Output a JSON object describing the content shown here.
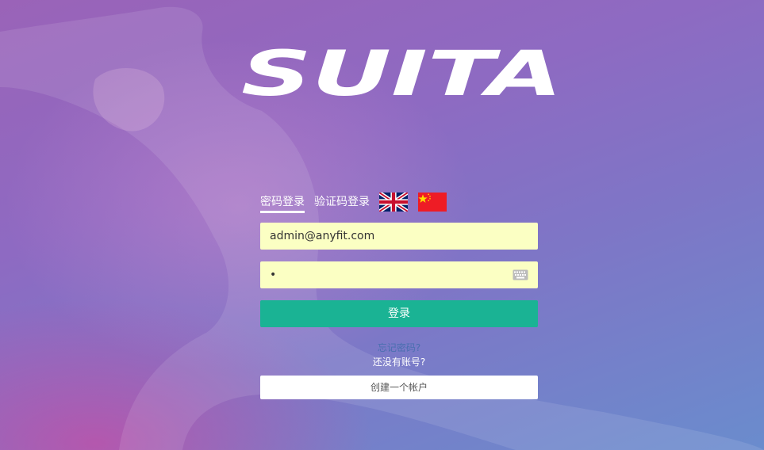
{
  "brand": {
    "logo_text": "SUITA"
  },
  "login": {
    "tabs": [
      {
        "label": "密码登录",
        "active": true
      },
      {
        "label": "验证码登录",
        "active": false
      }
    ],
    "languages": [
      "english-flag-icon",
      "chinese-flag-icon"
    ],
    "email": {
      "value": "admin@anyfit.com"
    },
    "password": {
      "value": "•"
    },
    "submit_label": "登录",
    "forgot_label": "忘记密码?",
    "no_account_text": "还没有账号?",
    "create_label": "创建一个帐户"
  },
  "colors": {
    "field_bg": "#fbffc3",
    "primary": "#1ab394",
    "link": "#4a6fb0"
  }
}
